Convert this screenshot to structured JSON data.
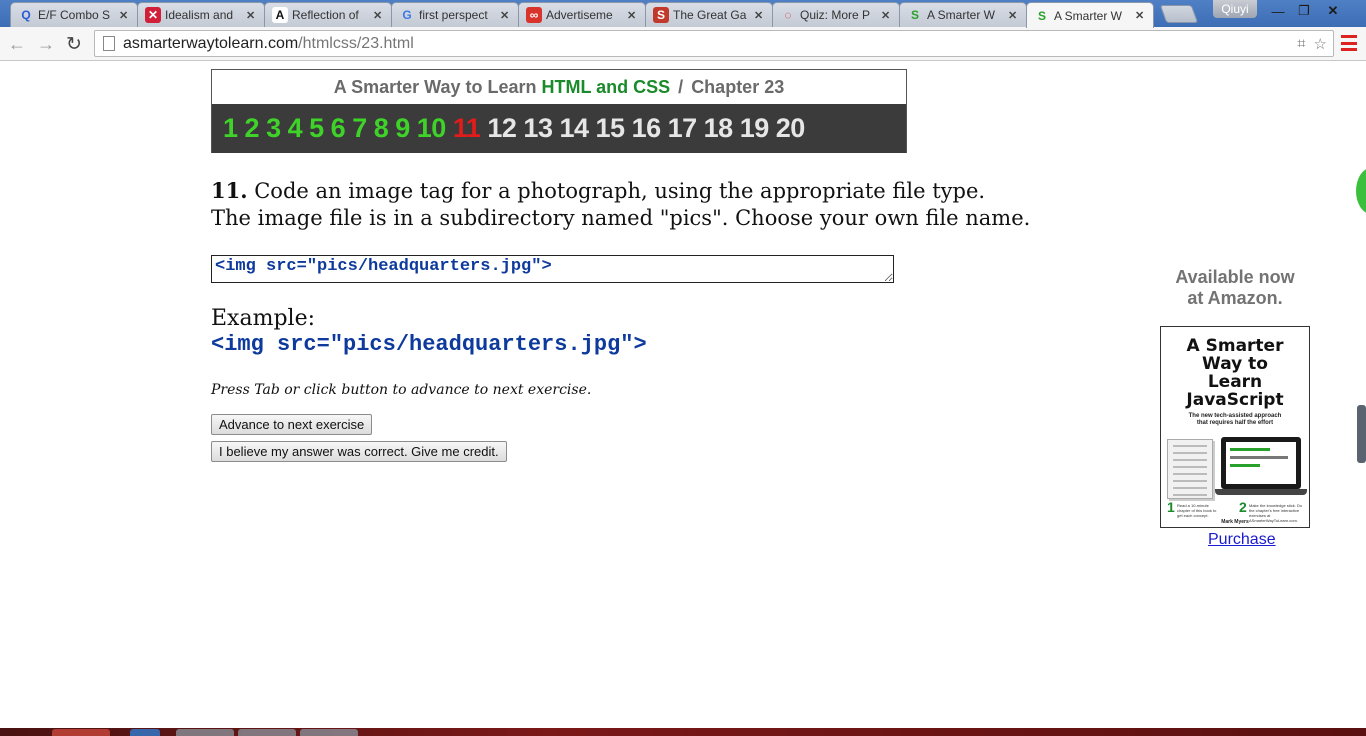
{
  "browser": {
    "tabs": [
      {
        "icon": "quora-icon",
        "label": "E/F Combo S",
        "fav_char": "Q",
        "fav_color": "#2a5bd7",
        "fav_bg": "transparent",
        "active": false
      },
      {
        "icon": "x-circle-icon",
        "label": "Idealism and",
        "fav_char": "✕",
        "fav_color": "#ffffff",
        "fav_bg": "#d11f3a",
        "active": false
      },
      {
        "icon": "letter-a-icon",
        "label": "Reflection of",
        "fav_char": "A",
        "fav_color": "#111111",
        "fav_bg": "#ffffff",
        "active": false
      },
      {
        "icon": "google-icon",
        "label": "first perspect",
        "fav_char": "G",
        "fav_color": "#3b78e7",
        "fav_bg": "transparent",
        "active": false
      },
      {
        "icon": "ad-infinity-icon",
        "label": "Advertiseme",
        "fav_char": "∞",
        "fav_color": "#ffffff",
        "fav_bg": "#d9342b",
        "active": false
      },
      {
        "icon": "stack-icon",
        "label": "The Great Ga",
        "fav_char": "S",
        "fav_color": "#ffffff",
        "fav_bg": "#c0392b",
        "active": false
      },
      {
        "icon": "quiz-ring-icon",
        "label": "Quiz: More P",
        "fav_char": "◌",
        "fav_color": "#d11f3a",
        "fav_bg": "transparent",
        "active": false
      },
      {
        "icon": "smarter-way-icon",
        "label": "A Smarter W",
        "fav_char": "S",
        "fav_color": "#2aa12a",
        "fav_bg": "transparent",
        "active": false
      },
      {
        "icon": "smarter-way-icon",
        "label": "A Smarter W",
        "fav_char": "S",
        "fav_color": "#2aa12a",
        "fav_bg": "transparent",
        "active": true
      }
    ],
    "user_name": "Qiuyi",
    "url_domain": "asmarterwaytolearn.com",
    "url_path": "/htmlcss/23.html"
  },
  "header": {
    "title_prefix": "A Smarter Way to Learn",
    "title_highlight": "HTML and CSS",
    "separator": "/",
    "chapter": "Chapter 23"
  },
  "exercises": {
    "numbers": [
      "1",
      "2",
      "3",
      "4",
      "5",
      "6",
      "7",
      "8",
      "9",
      "10",
      "11",
      "12",
      "13",
      "14",
      "15",
      "16",
      "17",
      "18",
      "19",
      "20"
    ],
    "current": "11",
    "completed_through": 10
  },
  "question": {
    "number": "11.",
    "text": "Code an image tag for a photograph, using the appropriate file type. The image file is in a subdirectory named \"pics\". Choose your own file name."
  },
  "answer": {
    "value": "<img src=\"pics/headquarters.jpg\">"
  },
  "example": {
    "label": "Example:",
    "code": "<img src=\"pics/headquarters.jpg\">"
  },
  "hint": "Press Tab or click button to advance to next exercise.",
  "buttons": {
    "advance": "Advance to next exercise",
    "credit": "I believe my answer was correct. Give me credit."
  },
  "sidebar": {
    "availability_line1": "Available now",
    "availability_line2": "at Amazon.",
    "book_title_1": "A Smarter",
    "book_title_2": "Way to",
    "book_title_3": "Learn",
    "book_title_4": "JavaScript",
    "book_subtitle_1": "The new tech-assisted approach",
    "book_subtitle_2": "that requires half the effort",
    "step1_num": "1",
    "step1_text": "Read a 10-minute chapter of this book to get each concept.",
    "step2_num": "2",
    "step2_text": "Make the knowledge stick. Do the chapter's free interactive exercises at ASmarterWayToLearn.com.",
    "author": "Mark Myers",
    "purchase_label": "Purchase"
  },
  "colors": {
    "accent_green": "#1a8a2a",
    "done_number": "#3fd32a",
    "current_number": "#e21b1b",
    "code_blue": "#0d3a9c"
  }
}
